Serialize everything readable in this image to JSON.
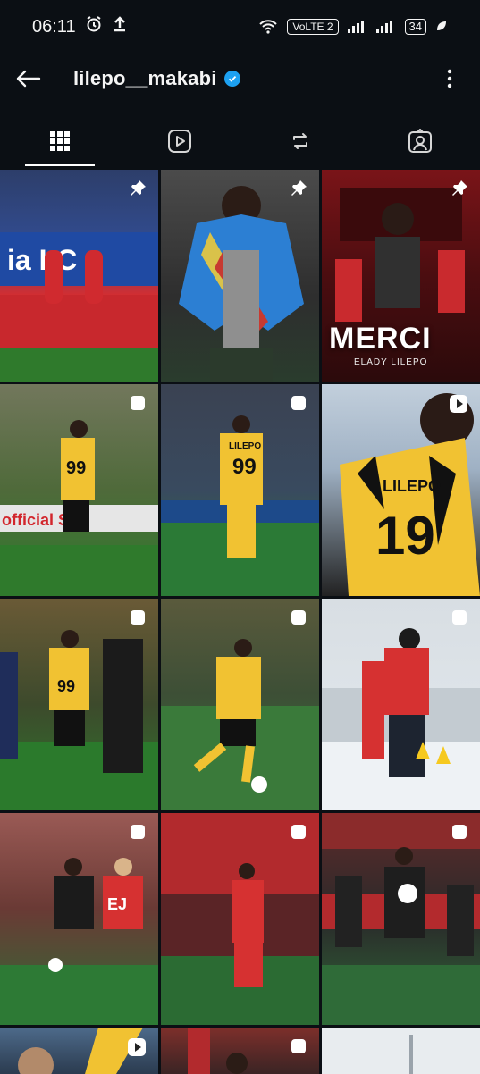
{
  "status": {
    "time": "06:11",
    "network": "VoLTE 2",
    "battery": "34"
  },
  "header": {
    "username": "lilepo__makabi"
  },
  "tabs": [
    {
      "name": "posts",
      "icon": "grid-icon",
      "active": true
    },
    {
      "name": "reels",
      "icon": "reels-icon",
      "active": false
    },
    {
      "name": "reposts",
      "icon": "repost-icon",
      "active": false
    },
    {
      "name": "tagged",
      "icon": "tagged-icon",
      "active": false
    }
  ],
  "posts": [
    {
      "badge": "pin-icon",
      "colors": [
        "#c6242c",
        "#1c6e2a"
      ],
      "text": "ia  LC"
    },
    {
      "badge": "pin-icon",
      "colors": [
        "#3f3f3f",
        "#2b3a2c"
      ],
      "text": ""
    },
    {
      "badge": "pin-icon",
      "colors": [
        "#6b0f12",
        "#1c1c1c"
      ],
      "title": "MERCI",
      "subtitle": "ELADY LILEPO"
    },
    {
      "badge": "carousel-icon",
      "colors": [
        "#4d6b34",
        "#25671f"
      ],
      "text": "99",
      "ad": "Official  SL"
    },
    {
      "badge": "carousel-icon",
      "colors": [
        "#374150",
        "#257a35"
      ],
      "text": "99",
      "name": "LILEPO"
    },
    {
      "badge": "reel-icon",
      "colors": [
        "#bcc9d6",
        "#1a1a1a"
      ],
      "text": "19",
      "name": "LILEPO"
    },
    {
      "badge": "carousel-icon",
      "colors": [
        "#5a4a2c",
        "#2d7a2c"
      ],
      "text": "99"
    },
    {
      "badge": "carousel-icon",
      "colors": [
        "#4d5a3a",
        "#37793a"
      ],
      "text": ""
    },
    {
      "badge": "carousel-icon",
      "colors": [
        "#d7dde2",
        "#e9eef2"
      ],
      "text": ""
    },
    {
      "badge": "carousel-icon",
      "colors": [
        "#8f5a52",
        "#2d6e35"
      ],
      "text": "EJ"
    },
    {
      "badge": "carousel-icon",
      "colors": [
        "#b2262c",
        "#2b6b33"
      ],
      "text": ""
    },
    {
      "badge": "carousel-icon",
      "colors": [
        "#2a2a2a",
        "#2f6b38"
      ],
      "text": ""
    },
    {
      "badge": "reel-icon",
      "colors": [
        "#3c4f6a",
        "#1f2c3b"
      ],
      "text": ""
    },
    {
      "badge": "carousel-icon",
      "colors": [
        "#7d2f2b",
        "#2b2b2b"
      ],
      "text": ""
    },
    {
      "badge": "none",
      "colors": [
        "#e8ecef",
        "#e8ecef"
      ],
      "text": ""
    }
  ]
}
